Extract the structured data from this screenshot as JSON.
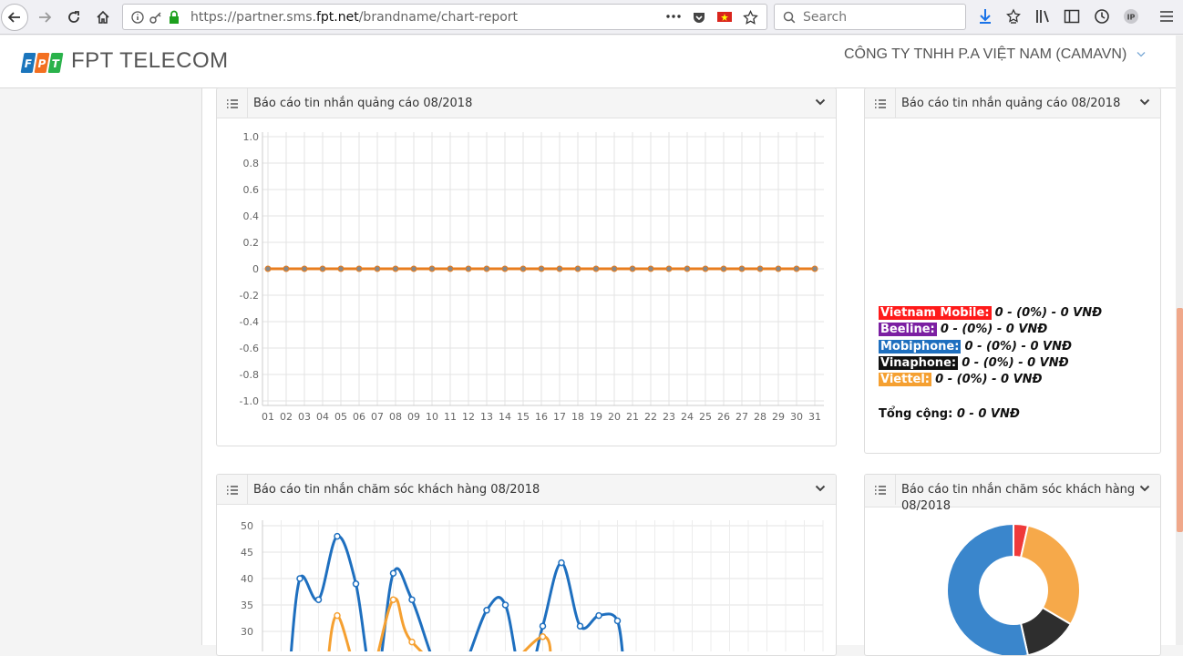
{
  "browser": {
    "url_prefix": "https://partner.sms.",
    "url_domain": "fpt.net",
    "url_path": "/brandname/chart-report",
    "search_placeholder": "Search"
  },
  "header": {
    "logo_text": "FPT TELECOM",
    "company": "CÔNG TY TNHH P.A VIỆT NAM (CAMAVN)"
  },
  "panels": {
    "ads_line_title": "Báo cáo tin nhắn quảng cáo 08/2018",
    "ads_summary_title": "Báo cáo tin nhắn quảng cáo 08/2018",
    "care_line_title": "Báo cáo tin nhắn chăm sóc khách hàng 08/2018",
    "care_donut_title": "Báo cáo tin nhắn chăm sóc khách hàng 08/2018"
  },
  "summary": {
    "items": [
      {
        "carrier": "Vietnam Mobile:",
        "value": "0 - (0%) - 0 VNĐ",
        "color": "#ff1a1a"
      },
      {
        "carrier": "Beeline:",
        "value": "0 - (0%) - 0 VNĐ",
        "color": "#7b1fa2"
      },
      {
        "carrier": "Mobiphone:",
        "value": "0 - (0%) - 0 VNĐ",
        "color": "#1e6fbf"
      },
      {
        "carrier": "Vinaphone:",
        "value": "0 - (0%) - 0 VNĐ",
        "color": "#111111"
      },
      {
        "carrier": "Viettel:",
        "value": "0 - (0%) - 0 VNĐ",
        "color": "#f5a031"
      }
    ],
    "total_label": "Tổng cộng:",
    "total_value": "0 - 0 VNĐ"
  },
  "chart_data": [
    {
      "type": "line",
      "x": [
        "01",
        "02",
        "03",
        "04",
        "05",
        "06",
        "07",
        "08",
        "09",
        "10",
        "11",
        "12",
        "13",
        "14",
        "15",
        "16",
        "17",
        "18",
        "19",
        "20",
        "21",
        "22",
        "23",
        "24",
        "25",
        "26",
        "27",
        "28",
        "29",
        "30",
        "31"
      ],
      "y_ticks": [
        "1.0",
        "0.8",
        "0.6",
        "0.4",
        "0.2",
        "0",
        "-0.2",
        "-0.4",
        "-0.6",
        "-0.8",
        "-1.0"
      ],
      "ylim": [
        -1,
        1
      ],
      "series": [
        {
          "values": [
            0,
            0,
            0,
            0,
            0,
            0,
            0,
            0,
            0,
            0,
            0,
            0,
            0,
            0,
            0,
            0,
            0,
            0,
            0,
            0,
            0,
            0,
            0,
            0,
            0,
            0,
            0,
            0,
            0,
            0,
            0
          ],
          "color": "#e87d1e"
        }
      ]
    },
    {
      "type": "line",
      "y_ticks": [
        "50",
        "45",
        "40",
        "35",
        "30"
      ],
      "ylim": [
        0,
        50
      ],
      "series": [
        {
          "points": [
            [
              2,
              40
            ],
            [
              3,
              36
            ],
            [
              4,
              48
            ],
            [
              5,
              39
            ],
            [
              7,
              41
            ],
            [
              8,
              36
            ],
            [
              12,
              34
            ],
            [
              13,
              35
            ],
            [
              15,
              31
            ],
            [
              16,
              43
            ],
            [
              17,
              31
            ],
            [
              18,
              33
            ],
            [
              19,
              32
            ]
          ],
          "color": "#1e6fbf"
        },
        {
          "points": [
            [
              4,
              33
            ],
            [
              7,
              36
            ],
            [
              8,
              28
            ],
            [
              15,
              29
            ]
          ],
          "color": "#f5a031"
        }
      ]
    },
    {
      "type": "pie",
      "values": [
        3.5,
        30,
        13,
        53.5
      ],
      "colors": [
        "#ef3a3a",
        "#f6a94a",
        "#2e2e2e",
        "#3a86cc"
      ]
    }
  ]
}
